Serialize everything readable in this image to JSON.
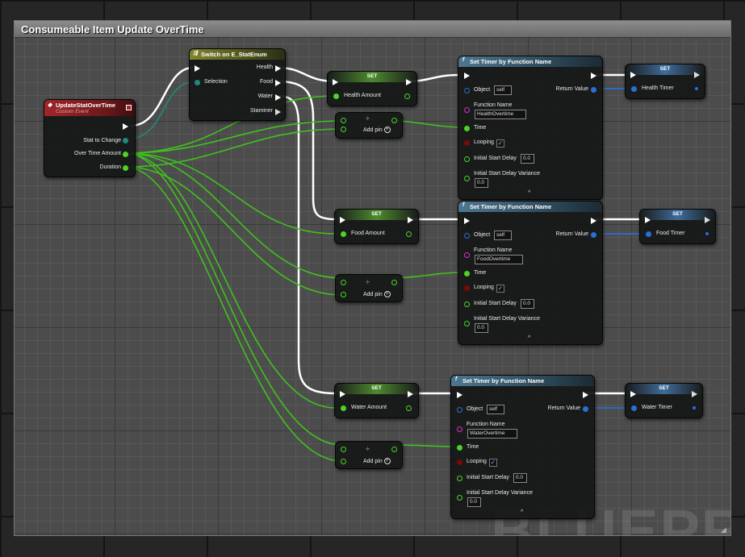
{
  "title": "Consumeable Item Update OverTime",
  "watermark": "BLUEPRI",
  "event": {
    "title": "UpdateStatOverTime",
    "subtitle": "Custom Event",
    "pins": [
      "Stat to Change",
      "Over Time Amount",
      "Duration"
    ]
  },
  "switch": {
    "title": "Switch on E_StatEnum",
    "input": "Selection",
    "outputs": [
      "Health",
      "Food",
      "Water",
      "Staminer"
    ]
  },
  "set_label": "SET",
  "divide": {
    "symbol": "÷",
    "add_pin": "Add pin"
  },
  "set_vars": [
    "Health Amount",
    "Food Amount",
    "Water Amount"
  ],
  "timer": {
    "title": "Set Timer by Function Name",
    "object_label": "Object",
    "object_value": "self",
    "function_label": "Function Name",
    "time_label": "Time",
    "looping_label": "Looping",
    "delay_label": "Initial Start Delay",
    "delay_value": "0.0",
    "variance_label": "Initial Start Delay Variance",
    "variance_value": "0.0",
    "return_label": "Return Value",
    "looping_checked": true,
    "functions": [
      "HealthOvertime",
      "FoodOvertime",
      "WaterOvertime"
    ]
  },
  "timer_vars": [
    "Health Timer",
    "Food Timer",
    "Water Timer"
  ],
  "colors": {
    "exec": "#ffffff",
    "float": "#4cd423",
    "byte": "#1f8a7c",
    "handle": "#2a6fd6",
    "function_name": "#d133c9"
  },
  "icons": {
    "event": "event-diamond-icon",
    "switch": "switch-icon",
    "function": "function-f-icon",
    "add": "plus-circle-icon",
    "expand": "chevron-up-icon"
  }
}
